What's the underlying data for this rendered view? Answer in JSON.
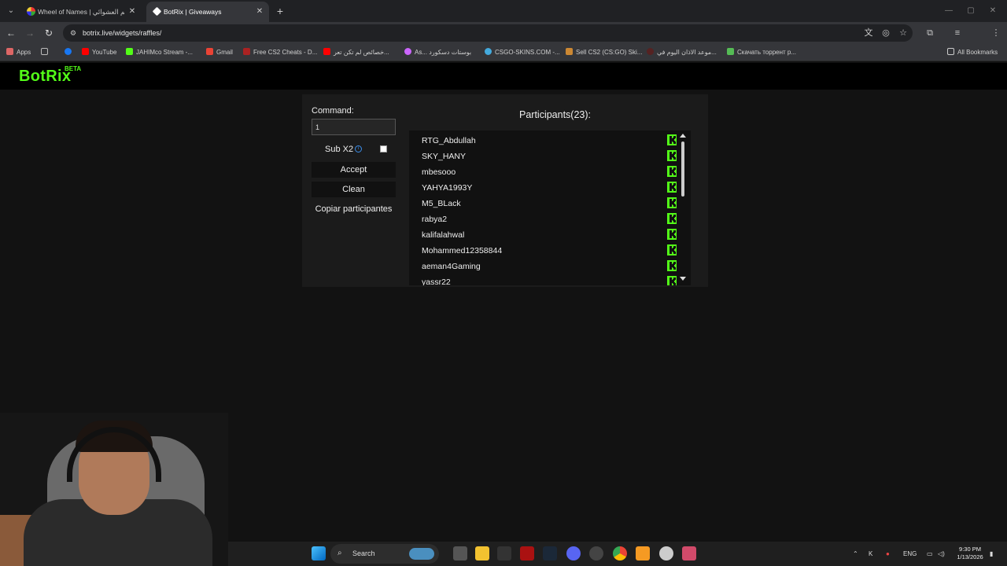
{
  "browser": {
    "tabs": [
      {
        "title": "Wheel of Names | اسم العشوائي",
        "active": false
      },
      {
        "title": "BotRix | Giveaways",
        "active": true
      }
    ],
    "url": "botrix.live/widgets/raffles/",
    "bookmarks": [
      "Apps",
      "YouTube",
      "JAHIMco Stream -...",
      "Gmail",
      "Free CS2 Cheats - D...",
      "خصائص لم تكن تعر...",
      "As... بوستات دسكورد",
      "CSGO-SKINS.COM -...",
      "Sell CS2 (CS:GO) Ski...",
      "موعد الاذان اليوم في...",
      "Скачать торрент р...",
      "All Bookmarks"
    ]
  },
  "app": {
    "logo": "BotRix",
    "logo_badge": "BETA"
  },
  "raffle": {
    "command_label": "Command:",
    "command_value": "1",
    "sub_label": "Sub X2",
    "sub_checked": false,
    "accept_label": "Accept",
    "clean_label": "Clean",
    "copy_label": "Copiar participantes",
    "participants_title": "Participants(23):",
    "participants": [
      "RTG_Abdullah",
      "SKY_HANY",
      "mbesooo",
      "YAHYA1993Y",
      "M5_BLack",
      "rabya2",
      "kalifalahwal",
      "Mohammed12358844",
      "aeman4Gaming",
      "yassr22"
    ],
    "platform_color": "#53fc18"
  },
  "taskbar": {
    "search_label": "Search",
    "language": "ENG",
    "time": "9:30 PM",
    "date": "1/13/2026"
  }
}
